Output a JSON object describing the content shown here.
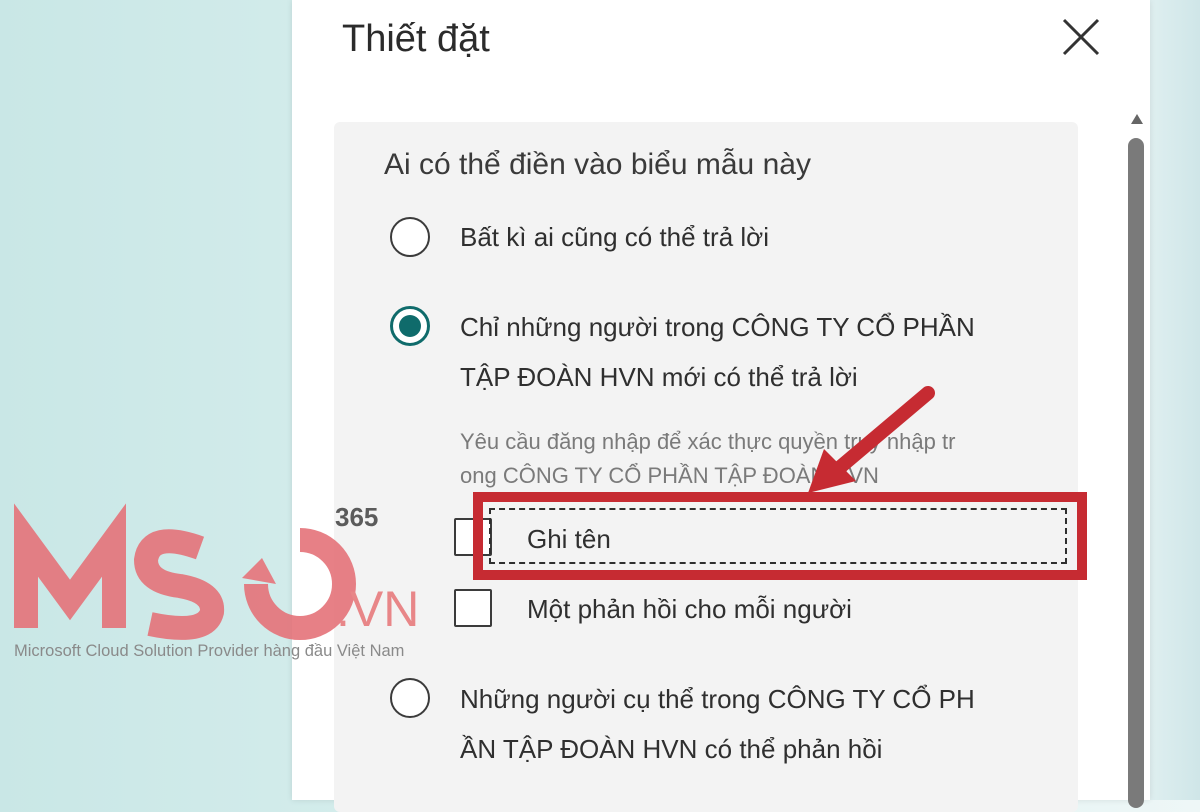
{
  "dialog": {
    "title": "Thiết đặt"
  },
  "section": {
    "heading": "Ai có thể điền vào biểu mẫu này",
    "options": [
      {
        "label_lines": [
          "Bất kì ai cũng có thể trả lời"
        ],
        "checked": false
      },
      {
        "label_lines": [
          "Chỉ những người trong CÔNG TY CỔ PHẦN",
          "TẬP ĐOÀN HVN mới có thể trả lời"
        ],
        "checked": true
      },
      {
        "label_lines": [
          "Những người cụ thể trong CÔNG TY CỔ PH",
          "ẦN TẬP ĐOÀN HVN có thể phản hồi"
        ],
        "checked": false
      }
    ],
    "note_lines": [
      "Yêu cầu đăng nhập để xác thực quyền truy nhập tr",
      "ong CÔNG TY CỔ PHẦN TẬP ĐOÀN HVN"
    ],
    "checkboxes": [
      {
        "label": "Ghi tên",
        "checked": false
      },
      {
        "label": "Một phản hồi cho mỗi người",
        "checked": false
      }
    ]
  },
  "watermark": {
    "brand": "MSO",
    "suffix": ".VN",
    "superscript": "365",
    "tagline": "Microsoft Cloud Solution Provider hàng đầu Việt Nam"
  },
  "colors": {
    "accent": "#0f6b6b",
    "highlight": "#c62b32",
    "watermark": "#e5737a"
  },
  "icons": {
    "close": "close-icon",
    "arrow": "red-arrow-icon"
  }
}
